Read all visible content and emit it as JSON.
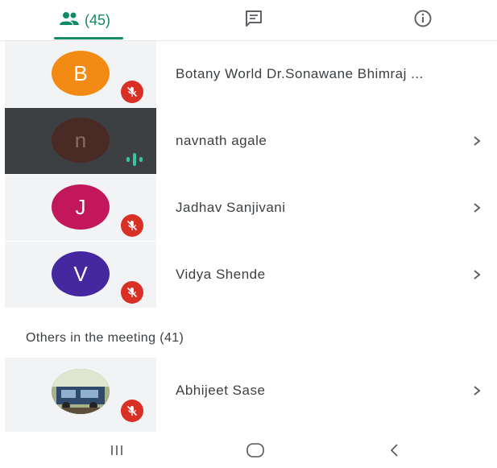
{
  "tabs": {
    "people_count": "(45)",
    "colors": {
      "active": "#0f8a66"
    }
  },
  "participants": [
    {
      "initial": "B",
      "name": "Botany World Dr.Sonawane Bhimraj ...",
      "avatar_color": "#f28a14",
      "mic": "muted"
    },
    {
      "initial": "n",
      "name": "navnath agale",
      "avatar_color": "#4a2a24",
      "mic": "speaking"
    },
    {
      "initial": "J",
      "name": "Jadhav Sanjivani",
      "avatar_color": "#c2185b",
      "mic": "muted"
    },
    {
      "initial": "V",
      "name": "Vidya Shende",
      "avatar_color": "#4527a0",
      "mic": "muted"
    }
  ],
  "others": {
    "label": "Others in the meeting (41)",
    "items": [
      {
        "name": "Abhijeet Sase",
        "avatar": "photo",
        "mic": "muted"
      }
    ]
  },
  "nav": {
    "icons": [
      "recents-icon",
      "home-icon",
      "back-icon"
    ]
  }
}
